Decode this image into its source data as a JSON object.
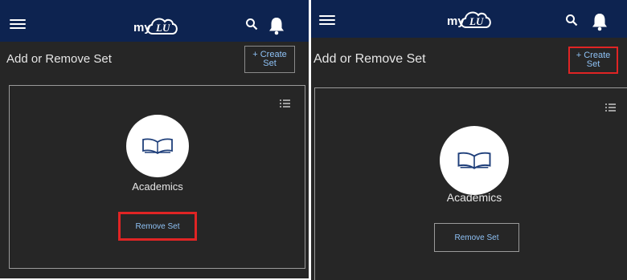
{
  "screens": [
    {
      "id": "left",
      "title": "Add or Remove Set",
      "create_button": {
        "line1": "+ Create",
        "line2": "Set",
        "highlighted": false
      },
      "card": {
        "label": "Academics",
        "remove_button": "Remove Set",
        "remove_highlighted": true
      }
    },
    {
      "id": "right",
      "title": "Add or Remove Set",
      "create_button": {
        "line1": "+ Create",
        "line2": "Set",
        "highlighted": true
      },
      "card": {
        "label": "Academics",
        "remove_button": "Remove Set",
        "remove_highlighted": false
      }
    }
  ],
  "brand": {
    "logo_text": "my",
    "logo_mark": "LU"
  },
  "icons": [
    "menu-icon",
    "logo-icon",
    "search-icon",
    "bell-icon",
    "list-view-icon",
    "book-icon"
  ],
  "colors": {
    "topbar": "#0d2350",
    "background": "#262626",
    "link": "#8ec1f5",
    "highlight": "#e02424"
  }
}
